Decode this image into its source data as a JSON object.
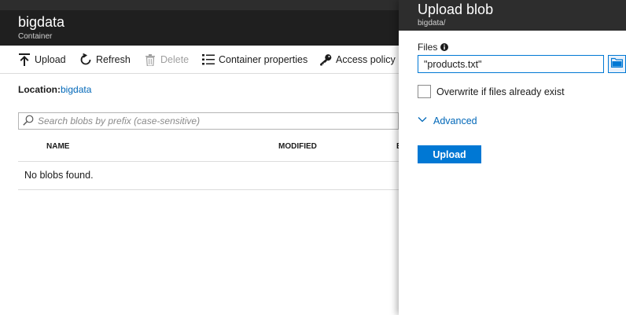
{
  "container": {
    "title": "bigdata",
    "subtitle": "Container"
  },
  "toolbar": {
    "upload": "Upload",
    "refresh": "Refresh",
    "delete": "Delete",
    "container_properties": "Container properties",
    "access_policy": "Access policy"
  },
  "location": {
    "label": "Location:",
    "value": "bigdata"
  },
  "search": {
    "placeholder": "Search blobs by prefix (case-sensitive)"
  },
  "table": {
    "columns": [
      "NAME",
      "MODIFIED",
      "B"
    ],
    "empty_message": "No blobs found."
  },
  "upload_panel": {
    "title": "Upload blob",
    "subtitle": "bigdata/",
    "files_label": "Files",
    "files_value": "\"products.txt\"",
    "overwrite_label": "Overwrite if files already exist",
    "overwrite_checked": false,
    "advanced_label": "Advanced",
    "upload_button": "Upload"
  },
  "colors": {
    "accent": "#0078d4",
    "link": "#0067b8",
    "header_bg": "#1f1f1f",
    "panel_header_bg": "#2d2d2d"
  },
  "icons": {
    "upload": "upload-arrow-icon",
    "refresh": "refresh-icon",
    "delete": "trash-icon",
    "properties": "list-icon",
    "access_policy": "key-icon",
    "search": "search-icon",
    "info": "info-icon",
    "browse": "folder-icon",
    "advanced": "chevron-down-icon"
  }
}
